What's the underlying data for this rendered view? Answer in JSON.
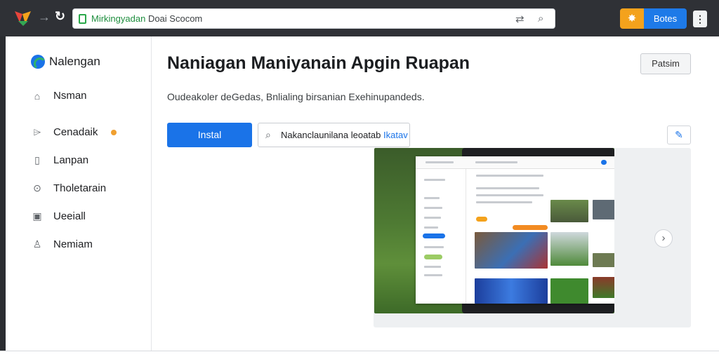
{
  "browser": {
    "url_host": "Mirkingyadan",
    "url_rest": " Doai Scocom",
    "profile_label": "Botes",
    "menu_label": "⋮"
  },
  "sidebar": {
    "brand": "Nalengan",
    "items": [
      {
        "label": "Nsman",
        "icon": "home-icon",
        "glyph": "⌂"
      },
      {
        "label": "Cenadaik",
        "icon": "tag-icon",
        "glyph": "⌲",
        "badge": true
      },
      {
        "label": "Lanpan",
        "icon": "file-icon",
        "glyph": "▯"
      },
      {
        "label": "Tholetarain",
        "icon": "circle-dot-icon",
        "glyph": "⊙"
      },
      {
        "label": "Ueeiall",
        "icon": "box-icon",
        "glyph": "▣"
      },
      {
        "label": "Nemiam",
        "icon": "person-icon",
        "glyph": "♙"
      }
    ]
  },
  "main": {
    "title": "Naniagan Maniyanain Apgin Ruapan",
    "top_button": "Patsim",
    "description": "Oudeakoler deGedas, Bnlialing birsanian Exehinupandeds.",
    "install_label": "Instal",
    "search_value": "Nakanclaunilana leoatab",
    "search_accent": "Ikatav"
  },
  "colors": {
    "accent": "#1a73e8",
    "extension": "#f4a21c",
    "badge": "#f0a030"
  }
}
